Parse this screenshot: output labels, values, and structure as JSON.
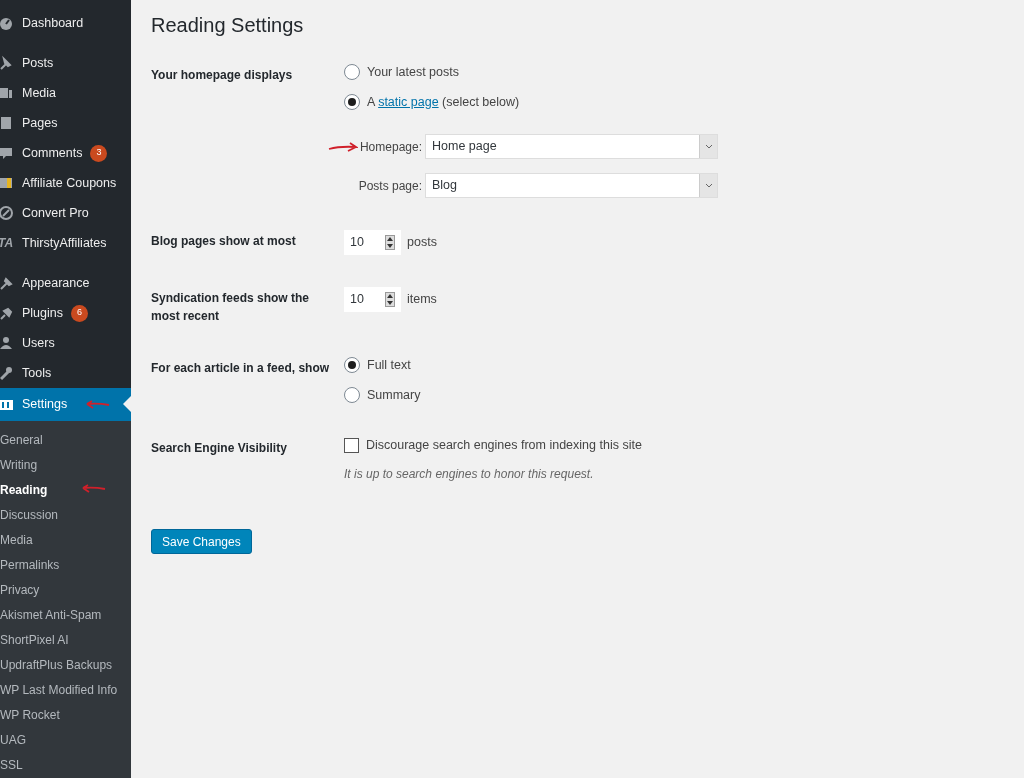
{
  "sidebar": {
    "menu_groups": [
      [
        {
          "label": "Dashboard",
          "selected": false
        }
      ],
      [
        {
          "label": "Posts",
          "selected": false
        },
        {
          "label": "Media",
          "selected": false
        },
        {
          "label": "Pages",
          "selected": false
        },
        {
          "label": "Comments",
          "badge": "3",
          "selected": false
        },
        {
          "label": "Affiliate Coupons",
          "selected": false
        },
        {
          "label": "Convert Pro",
          "selected": false
        },
        {
          "label": "ThirstyAffiliates",
          "icon_text": "TA",
          "selected": false
        }
      ],
      [
        {
          "label": "Appearance",
          "selected": false
        },
        {
          "label": "Plugins",
          "badge": "6",
          "selected": false
        },
        {
          "label": "Users",
          "selected": false
        },
        {
          "label": "Tools",
          "selected": false
        },
        {
          "label": "Settings",
          "selected": true
        }
      ]
    ],
    "submenu": [
      {
        "label": "General",
        "selected": false
      },
      {
        "label": "Writing",
        "selected": false
      },
      {
        "label": "Reading",
        "selected": true
      },
      {
        "label": "Discussion",
        "selected": false
      },
      {
        "label": "Media",
        "selected": false
      },
      {
        "label": "Permalinks",
        "selected": false
      },
      {
        "label": "Privacy",
        "selected": false
      },
      {
        "label": "Akismet Anti-Spam",
        "selected": false
      },
      {
        "label": "ShortPixel AI",
        "selected": false
      },
      {
        "label": "UpdraftPlus Backups",
        "selected": false
      },
      {
        "label": "WP Last Modified Info",
        "selected": false
      },
      {
        "label": "WP Rocket",
        "selected": false
      },
      {
        "label": "UAG",
        "selected": false
      },
      {
        "label": "SSL",
        "selected": false
      }
    ]
  },
  "page_title": "Reading Settings",
  "rows": [
    {
      "kind": "radios",
      "label": "Your homepage displays",
      "options": [
        {
          "label": "Your latest posts",
          "selected": false
        },
        {
          "label": "A **static page** (select below)",
          "selected": true
        }
      ],
      "selects": [
        {
          "label": "Homepage:",
          "value": "Home page"
        },
        {
          "label": "Posts page:",
          "value": "Blog"
        }
      ]
    },
    {
      "kind": "number",
      "label": "Blog pages show at most",
      "value": "10",
      "unit": "posts"
    },
    {
      "kind": "number",
      "label": "Syndication feeds show the most recent",
      "value": "10",
      "unit": "items"
    },
    {
      "kind": "radios",
      "label": "For each article in a feed, show",
      "options": [
        {
          "label": "Full text",
          "selected": true
        },
        {
          "label": "Summary",
          "selected": false
        }
      ]
    },
    {
      "kind": "checkbox",
      "label": "Search Engine Visibility",
      "text": "Discourage search engines from indexing this site",
      "checked": false,
      "note": "It is up to search engines to honor this request."
    }
  ],
  "save_button": "Save Changes"
}
